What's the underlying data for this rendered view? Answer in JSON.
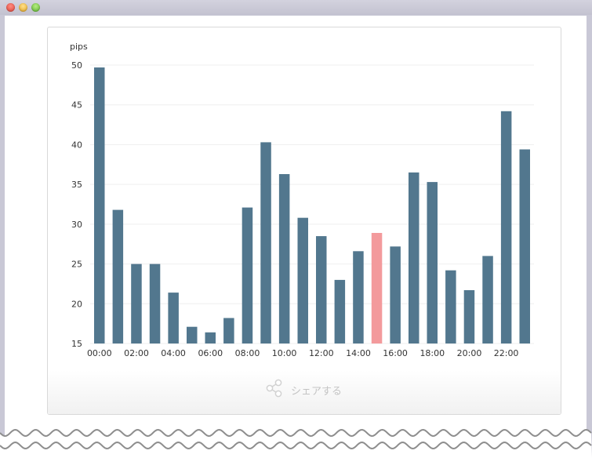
{
  "footer": {
    "share_label": "シェアする",
    "share_icon": "share-icon"
  },
  "colors": {
    "bar": "#52778e",
    "highlight": "#f39a9c",
    "grid": "#efefef",
    "text": "#333333"
  },
  "chart_data": {
    "type": "bar",
    "title": "",
    "xlabel": "",
    "ylabel": "pips",
    "ylim": [
      15,
      50
    ],
    "yticks": [
      15,
      20,
      25,
      30,
      35,
      40,
      45,
      50
    ],
    "grid": true,
    "categories": [
      "00:00",
      "01:00",
      "02:00",
      "03:00",
      "04:00",
      "05:00",
      "06:00",
      "07:00",
      "08:00",
      "09:00",
      "10:00",
      "11:00",
      "12:00",
      "13:00",
      "14:00",
      "15:00",
      "16:00",
      "17:00",
      "18:00",
      "19:00",
      "20:00",
      "21:00",
      "22:00",
      "23:00"
    ],
    "xtick_labels": [
      "00:00",
      "02:00",
      "04:00",
      "06:00",
      "08:00",
      "10:00",
      "12:00",
      "14:00",
      "16:00",
      "18:00",
      "20:00",
      "22:00"
    ],
    "series": [
      {
        "values": [
          49.7,
          31.8,
          25.0,
          25.0,
          21.4,
          17.1,
          16.4,
          18.2,
          32.1,
          40.3,
          36.3,
          30.8,
          28.5,
          23.0,
          26.6,
          28.9,
          27.2,
          36.5,
          35.3,
          24.2,
          21.7,
          26.0,
          44.2,
          39.4
        ]
      }
    ],
    "highlight_index": 15
  }
}
